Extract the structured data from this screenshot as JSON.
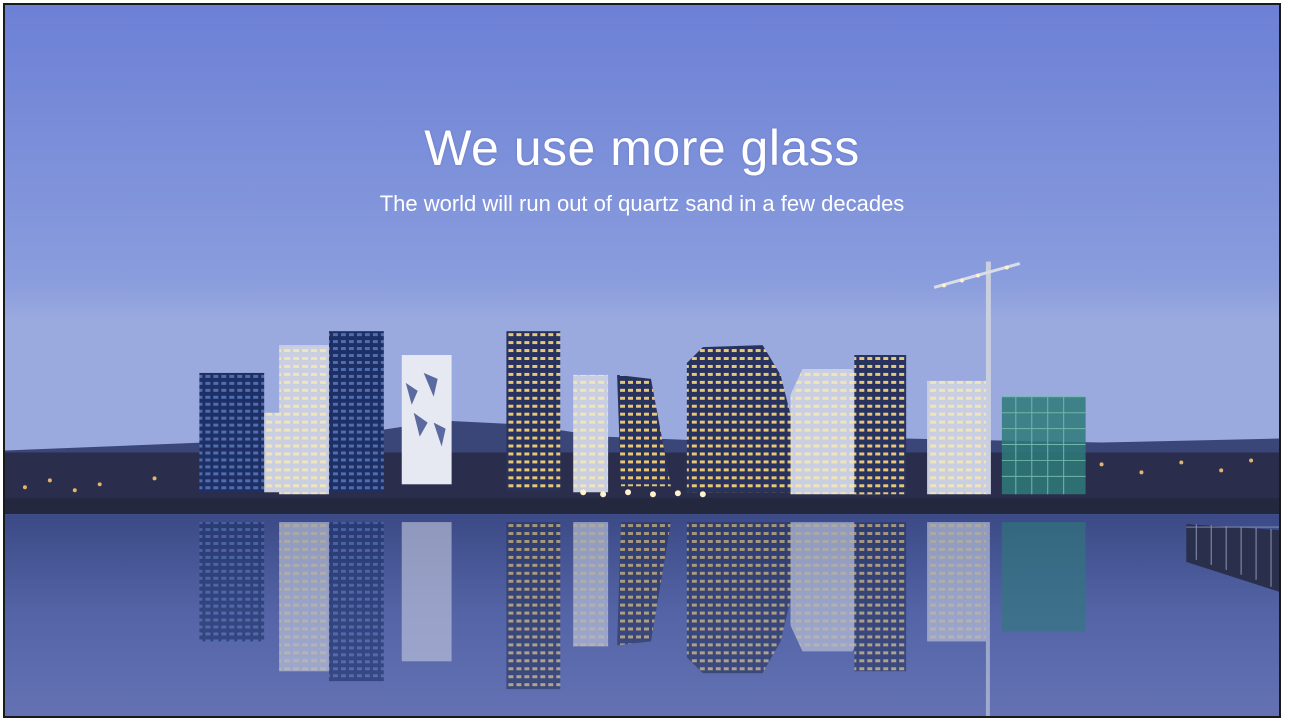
{
  "slide": {
    "title": "We use more glass",
    "subtitle": "The world will run out of quartz sand in a few decades"
  },
  "background": {
    "description_icon": "city-skyline-reflection-photo",
    "sky_top_color": "#6f82d8",
    "water_color": "#4a5c9c"
  }
}
